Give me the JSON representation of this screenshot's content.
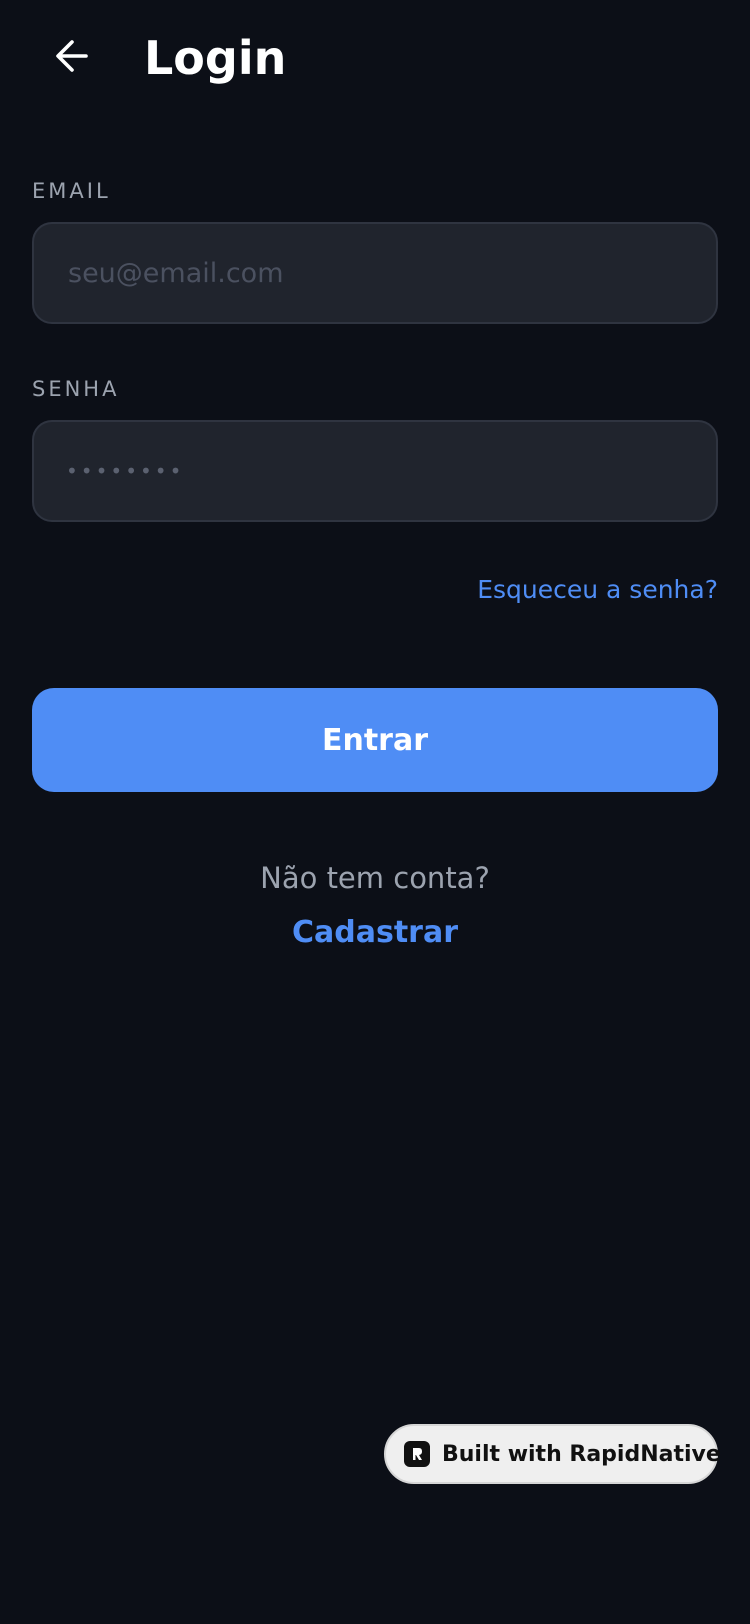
{
  "header": {
    "back_icon": "arrow-left-icon",
    "title": "Login"
  },
  "form": {
    "email": {
      "label": "EMAIL",
      "placeholder": "seu@email.com",
      "value": ""
    },
    "password": {
      "label": "SENHA",
      "placeholder": "••••••••",
      "value": ""
    },
    "forgot_label": "Esqueceu a senha?",
    "submit_label": "Entrar"
  },
  "signup": {
    "prompt": "Não tem conta?",
    "link_label": "Cadastrar"
  },
  "badge": {
    "icon": "rapidnative-logo-icon",
    "label": "Built with RapidNative"
  },
  "colors": {
    "background": "#0c0f17",
    "accent": "#4f8df5",
    "input_bg": "#20242d",
    "muted_text": "#9ca3af"
  }
}
